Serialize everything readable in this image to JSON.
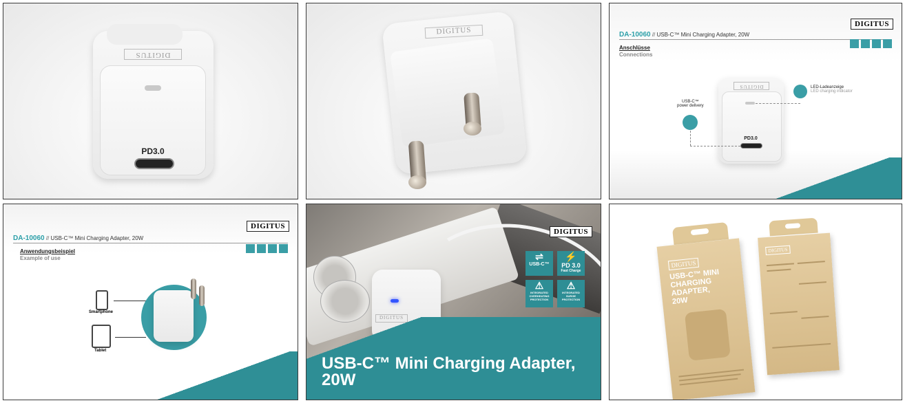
{
  "brand": "DIGITUS",
  "tile1": {
    "pd_label": "PD3.0",
    "emboss_logo": "DIGITUS"
  },
  "tile2": {
    "emboss_logo": "DIGITUS"
  },
  "tile3": {
    "sku": "DA-10060",
    "sep": " // ",
    "title": "USB-C™ Mini Charging Adapter, 20W",
    "section_de": "Anschlüsse",
    "section_en": "Connections",
    "callout_led_de": "LED-Ladeanzeige",
    "callout_led_en": "LED charging indicator",
    "callout_usbc_1": "USB-C™",
    "callout_usbc_2": "power delivery",
    "pd_label": "PD3.0",
    "emboss_logo": "DIGITUS"
  },
  "tile4": {
    "sku": "DA-10060",
    "sep": " // ",
    "title": "USB-C™ Mini Charging Adapter, 20W",
    "section_de": "Anwendungsbeispiel",
    "section_en": "Example of use",
    "device_1": "Smartphone",
    "device_2": "Tablet"
  },
  "tile5": {
    "headline_1": "USB-C™ Mini Charging Adapter,",
    "headline_2": "20W",
    "feat_usbc": "USB-C™",
    "feat_pd": "PD 3.0",
    "feat_pd_sub": "Fast Charge",
    "feat_overheat": "INTEGRATED OVERHEATING PROTECTION",
    "feat_surge": "INTEGRATED SURGE PROTECTION"
  },
  "tile6": {
    "box_title_1": "USB-C™ MINI",
    "box_title_2": "CHARGING ADAPTER,",
    "box_title_3": "20W"
  },
  "colors": {
    "accent": "#2e8e95",
    "sku": "#2c9fa8"
  }
}
